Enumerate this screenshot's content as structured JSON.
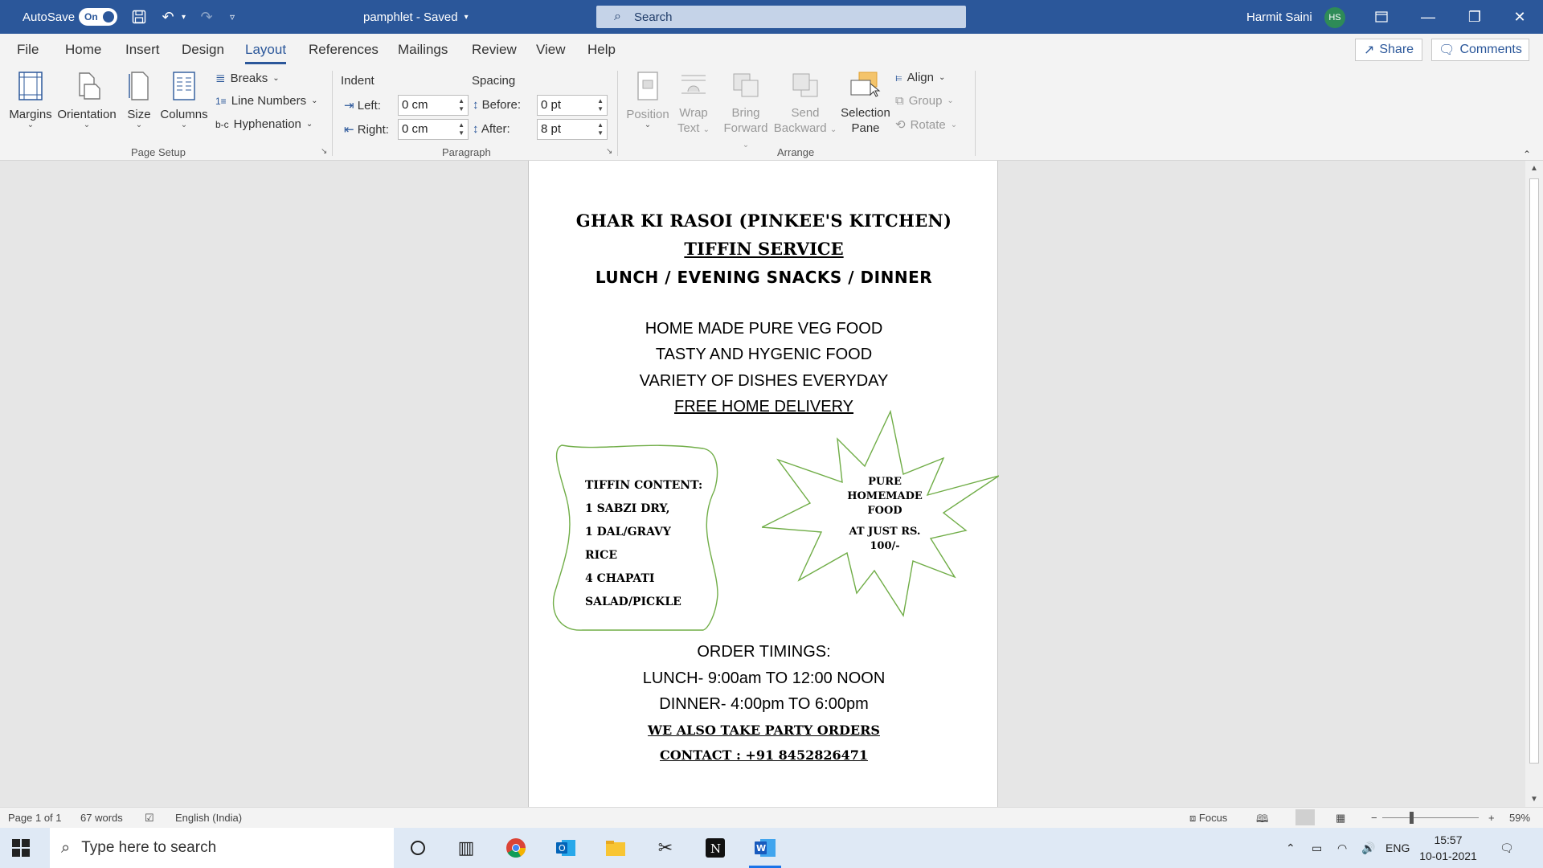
{
  "titlebar": {
    "autosave_label": "AutoSave",
    "autosave_state": "On",
    "doc_title": "pamphlet  -  Saved",
    "search_placeholder": "Search",
    "user_name": "Harmit Saini",
    "user_initials": "HS",
    "accent": "#2b579a"
  },
  "menu": {
    "tabs": [
      "File",
      "Home",
      "Insert",
      "Design",
      "Layout",
      "References",
      "Mailings",
      "Review",
      "View",
      "Help"
    ],
    "active_tab": "Layout",
    "share_label": "Share",
    "comments_label": "Comments"
  },
  "ribbon": {
    "page_setup": {
      "margins": "Margins",
      "orientation": "Orientation",
      "size": "Size",
      "columns": "Columns",
      "breaks": "Breaks",
      "line_numbers": "Line Numbers",
      "hyphenation": "Hyphenation",
      "group_label": "Page Setup"
    },
    "paragraph": {
      "indent_label": "Indent",
      "spacing_label": "Spacing",
      "left_label": "Left:",
      "left_value": "0 cm",
      "right_label": "Right:",
      "right_value": "0 cm",
      "before_label": "Before:",
      "before_value": "0 pt",
      "after_label": "After:",
      "after_value": "8 pt",
      "group_label": "Paragraph"
    },
    "arrange": {
      "position": "Position",
      "wrap_text_1": "Wrap",
      "wrap_text_2": "Text",
      "bring_forward_1": "Bring",
      "bring_forward_2": "Forward",
      "send_backward_1": "Send",
      "send_backward_2": "Backward",
      "selection_pane_1": "Selection",
      "selection_pane_2": "Pane",
      "align": "Align",
      "group": "Group",
      "rotate": "Rotate",
      "group_label": "Arrange"
    }
  },
  "document": {
    "title": "GHAR KI RASOI (PINKEE'S KITCHEN)",
    "subtitle": "TIFFIN SERVICE",
    "meals": "LUNCH / EVENING SNACKS / DINNER",
    "features": [
      "HOME MADE PURE VEG FOOD",
      "TASTY AND HYGENIC FOOD",
      "VARIETY OF DISHES EVERYDAY"
    ],
    "delivery": "FREE HOME DELIVERY",
    "tiffin_content": [
      "TIFFIN CONTENT:",
      "1 SABZI DRY,",
      "1 DAL/GRAVY",
      "RICE",
      "4 CHAPATI",
      "SALAD/PICKLE"
    ],
    "starburst_1": "PURE",
    "starburst_2": "HOMEMADE",
    "starburst_3": "FOOD",
    "starburst_4": "AT JUST RS.",
    "starburst_5": "100/-",
    "order_heading": "ORDER TIMINGS:",
    "lunch_time": "LUNCH- 9:00am TO 12:00 NOON",
    "dinner_time": "DINNER- 4:00pm TO 6:00pm",
    "party": "WE ALSO TAKE PARTY ORDERS",
    "contact": "CONTACT : +91 8452826471"
  },
  "statusbar": {
    "page": "Page 1 of 1",
    "words": "67 words",
    "language": "English (India)",
    "focus": "Focus",
    "zoom": "59%"
  },
  "taskbar": {
    "search_placeholder": "Type here to search",
    "language": "ENG",
    "time": "15:57",
    "date": "10-01-2021"
  }
}
